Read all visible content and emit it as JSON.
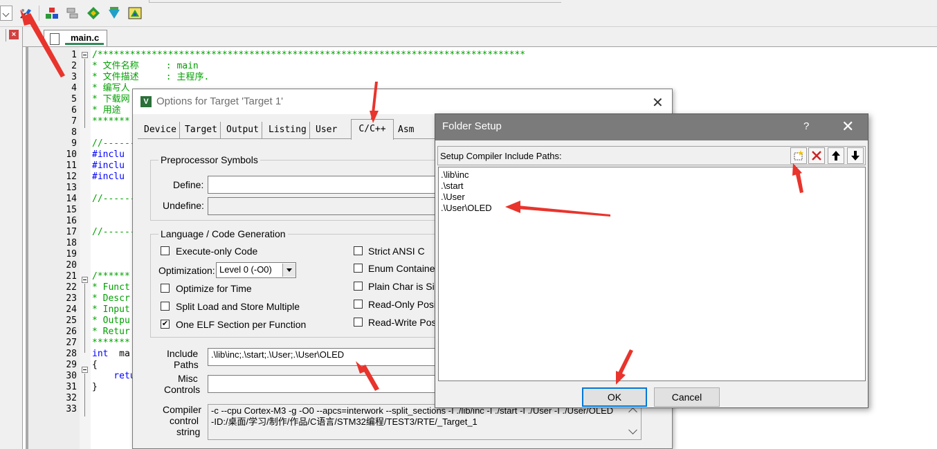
{
  "editor": {
    "tab_label": "main.c",
    "line_numbers": [
      "1",
      "2",
      "3",
      "4",
      "5",
      "6",
      "7",
      "8",
      "9",
      "10",
      "11",
      "12",
      "13",
      "14",
      "15",
      "16",
      "17",
      "18",
      "19",
      "20",
      "21",
      "22",
      "23",
      "24",
      "25",
      "26",
      "27",
      "28",
      "29",
      "30",
      "31",
      "32",
      "33"
    ],
    "lines": {
      "l1": "/*******************************************************************************",
      "l2": "* 文件名称     : main",
      "l3": "* 文件描述     : 主程序.",
      "l4": "* 编写人",
      "l5": "* 下载网",
      "l6": "* 用途",
      "l7": "*******",
      "l9": "//------",
      "l10": "#inclu",
      "l11": "#inclu",
      "l12": "#inclu",
      "l14": "//------",
      "l17": "//------",
      "l21": "/******",
      "l22": "* Funct",
      "l23": "* Descr",
      "l24": "* Input",
      "l25": "* Outpu",
      "l26": "* Retur",
      "l27": "*******",
      "l28_kw": "int",
      "l28_rest": "  ma",
      "l29": "{",
      "l30": "    retu",
      "l31": "}"
    }
  },
  "options_dialog": {
    "title": "Options for Target 'Target 1'",
    "tabs": [
      "Device",
      "Target",
      "Output",
      "Listing",
      "User",
      "C/C++",
      "Asm"
    ],
    "active_tab": "C/C++",
    "preprocessor": {
      "group_label": "Preprocessor Symbols",
      "define_label": "Define:",
      "define_value": "",
      "undefine_label": "Undefine:",
      "undefine_value": ""
    },
    "language": {
      "group_label": "Language / Code Generation",
      "execute_only": "Execute-only Code",
      "optimization_label": "Optimization:",
      "optimization_value": "Level 0 (-O0)",
      "optimize_time": "Optimize for Time",
      "split_load": "Split Load and Store Multiple",
      "one_elf": "One ELF Section per Function",
      "strict_ansi": "Strict ANSI C",
      "enum_container": "Enum Container",
      "plain_char": "Plain Char is Sig",
      "ro_pos": "Read-Only Posit",
      "rw_pos": "Read-Write Posi"
    },
    "checks": {
      "execute_only": "",
      "optimize_time": "",
      "split_load": "",
      "one_elf": "✔",
      "strict_ansi": "",
      "enum_container": "",
      "plain_char": "",
      "ro_pos": "",
      "rw_pos": ""
    },
    "include_label_1": "Include",
    "include_label_2": "Paths",
    "include_value": ".\\lib\\inc;.\\start;.\\User;.\\User\\OLED",
    "misc_label_1": "Misc",
    "misc_label_2": "Controls",
    "misc_value": "",
    "ccs_label_1": "Compiler",
    "ccs_label_2": "control",
    "ccs_label_3": "string",
    "ccs_line1": "-c --cpu Cortex-M3 -g -O0 --apcs=interwork --split_sections -I ./lib/inc -I ./start -I ./User -I ./User/OLED",
    "ccs_line2": "-ID:/桌面/学习/制作/作品/C语言/STM32编程/TEST3/RTE/_Target_1"
  },
  "folder_setup": {
    "title": "Folder Setup",
    "help": "?",
    "header_label": "Setup Compiler Include Paths:",
    "paths": [
      ".\\lib\\inc",
      ".\\start",
      ".\\User",
      ".\\User\\OLED"
    ],
    "ok_label": "OK",
    "cancel_label": "Cancel"
  },
  "colors": {
    "comment_green": "#00a000",
    "keyword_blue": "#0000ff",
    "annotation_arrow": "#e8342c",
    "dialog_title_bar": "#7b7b7b"
  }
}
